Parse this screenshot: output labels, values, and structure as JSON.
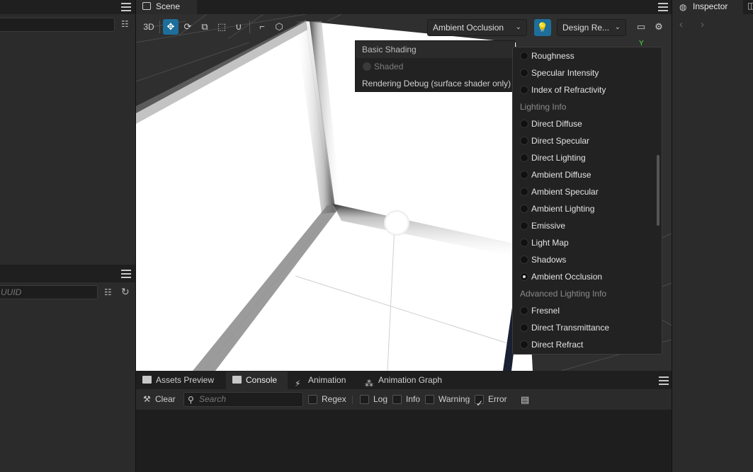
{
  "left_panel": {
    "top_search_placeholder": "",
    "bottom_search_placeholder": "UUID"
  },
  "scene": {
    "tab_label": "Scene",
    "toolbar": {
      "mode_3d": "3D",
      "view_dropdown": "Ambient Occlusion",
      "design_dropdown": "Design Re...",
      "axis_label": "Y"
    },
    "basic_popup": {
      "header": "Basic Shading",
      "shaded": "Shaded",
      "rendering_debug": "Rendering Debug (surface shader only)"
    },
    "debug_list": {
      "items_before": [
        {
          "label": "Roughness",
          "selected": false
        },
        {
          "label": "Specular Intensity",
          "selected": false
        },
        {
          "label": "Index of Refractivity",
          "selected": false
        }
      ],
      "section_lighting": "Lighting Info",
      "lighting_items": [
        {
          "label": "Direct Diffuse",
          "selected": false
        },
        {
          "label": "Direct Specular",
          "selected": false
        },
        {
          "label": "Direct Lighting",
          "selected": false
        },
        {
          "label": "Ambient Diffuse",
          "selected": false
        },
        {
          "label": "Ambient Specular",
          "selected": false
        },
        {
          "label": "Ambient Lighting",
          "selected": false
        },
        {
          "label": "Emissive",
          "selected": false
        },
        {
          "label": "Light Map",
          "selected": false
        },
        {
          "label": "Shadows",
          "selected": false
        },
        {
          "label": "Ambient Occlusion",
          "selected": true
        }
      ],
      "section_advanced": "Advanced Lighting Info",
      "advanced_items": [
        {
          "label": "Fresnel",
          "selected": false
        },
        {
          "label": "Direct Transmittance",
          "selected": false
        },
        {
          "label": "Direct Refract",
          "selected": false
        }
      ]
    }
  },
  "bottom": {
    "tabs": [
      {
        "label": "Assets Preview",
        "active": false
      },
      {
        "label": "Console",
        "active": true
      },
      {
        "label": "Animation",
        "active": false
      },
      {
        "label": "Animation Graph",
        "active": false
      }
    ],
    "console": {
      "clear_label": "Clear",
      "search_placeholder": "Search",
      "filters": [
        {
          "label": "Regex",
          "checked": false
        },
        {
          "label": "Log",
          "checked": false
        },
        {
          "label": "Info",
          "checked": false
        },
        {
          "label": "Warning",
          "checked": false
        },
        {
          "label": "Error",
          "checked": true
        }
      ]
    }
  },
  "right_panel": {
    "tab_label": "Inspector",
    "back_icon": "chevron-left-icon",
    "forward_icon": "chevron-right-icon"
  },
  "colors": {
    "accent": "#1d6e9a",
    "panel": "#2b2b2b",
    "header": "#1f1f1f",
    "axis_y": "#49e649"
  }
}
